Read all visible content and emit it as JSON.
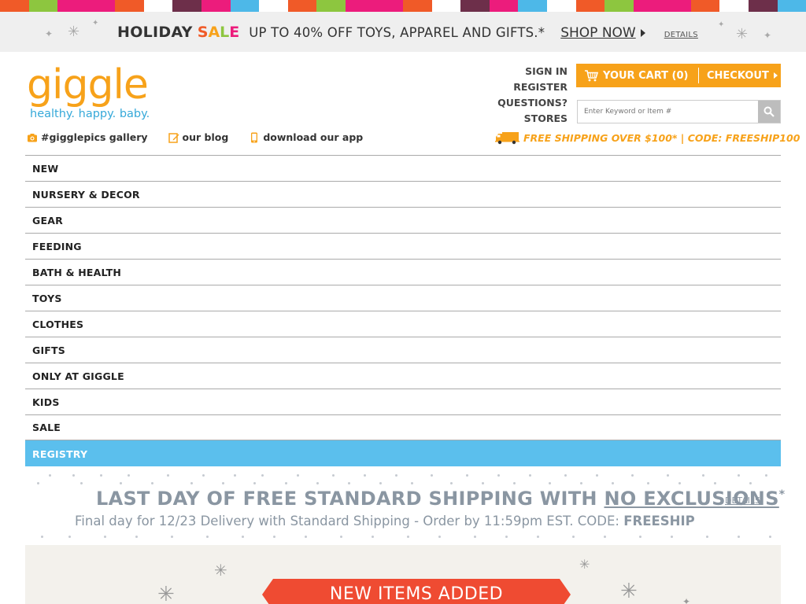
{
  "stripe_colors": [
    "#f05a28",
    "#8dc63f",
    "#ec1c7c",
    "#ec1c7c",
    "#f05a28",
    "#ffffff",
    "#6d2f4a",
    "#ec1c7c",
    "#4db8e8",
    "#ffffff",
    "#f05a28",
    "#8dc63f",
    "#ec1c7c",
    "#ec1c7c",
    "#f05a28",
    "#ffffff",
    "#6d2f4a",
    "#ec1c7c",
    "#4db8e8",
    "#ffffff",
    "#f05a28",
    "#8dc63f",
    "#ec1c7c",
    "#ec1c7c",
    "#f05a28",
    "#ffffff",
    "#6d2f4a",
    "#4db8e8"
  ],
  "holiday_banner": {
    "holiday": "HOLIDAY",
    "sale_letters": [
      {
        "ch": "S",
        "color": "#f05a28"
      },
      {
        "ch": "A",
        "color": "#f7a21a"
      },
      {
        "ch": "L",
        "color": "#8dc63f"
      },
      {
        "ch": "E",
        "color": "#ec1c7c"
      }
    ],
    "offer": "UP TO 40% OFF TOYS, APPAREL AND GIFTS.*",
    "shop_now": "SHOP NOW",
    "details": "DETAILS"
  },
  "logo": {
    "wordmark": "giggle",
    "tagline": "healthy. happy. baby."
  },
  "utility_links": [
    {
      "label": "#gigglepics gallery",
      "icon": "camera-icon"
    },
    {
      "label": "our blog",
      "icon": "pencil-icon"
    },
    {
      "label": "download our app",
      "icon": "phone-icon"
    }
  ],
  "account_links": [
    "SIGN IN",
    "REGISTER",
    "QUESTIONS?",
    "STORES"
  ],
  "cart": {
    "label": "YOUR CART (0)",
    "checkout": "CHECKOUT",
    "icon": "cart-icon"
  },
  "search": {
    "placeholder": "Enter Keyword or Item #",
    "icon": "search-icon"
  },
  "shipping": {
    "text": "FREE SHIPPING OVER $100* | CODE: FREESHIP100",
    "icon": "truck-icon"
  },
  "nav_items": [
    "NEW",
    "NURSERY & DECOR",
    "GEAR",
    "FEEDING",
    "BATH & HEALTH",
    "TOYS",
    "CLOTHES",
    "GIFTS",
    "ONLY AT GIGGLE",
    "KIDS",
    "SALE",
    "REGISTRY"
  ],
  "promo": {
    "headline_part1": "LAST DAY OF FREE STANDARD SHIPPING WITH ",
    "headline_part2": "NO EXCLUSIONS",
    "asterisk": "*",
    "details": "DETAILS",
    "sub_part1": "Final day for 12/23 Delivery with Standard Shipping - Order by 11:59pm EST. CODE: ",
    "sub_code": "FREESHIP"
  },
  "new_items": {
    "label": "NEW ITEMS ADDED"
  },
  "colors": {
    "brand_orange": "#f7a21a",
    "brand_blue": "#36a9d9",
    "registry_blue": "#5bbfed",
    "promo_gray": "#8a96a2",
    "ribbon_red": "#ef4b32"
  }
}
